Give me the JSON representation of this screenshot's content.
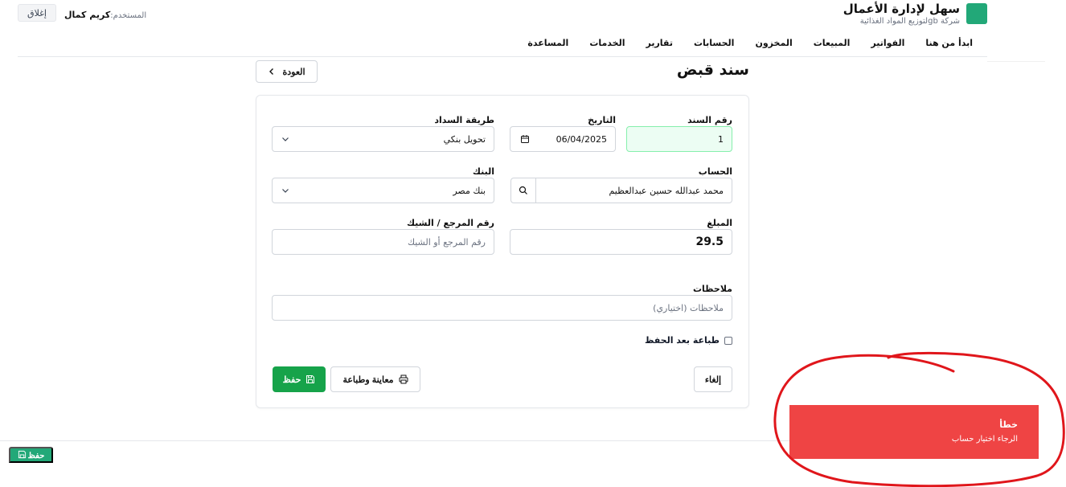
{
  "app": {
    "title": "سهل لإدارة الأعمال",
    "subtitle": "شركة gbلتوزيع المواد الغذائية",
    "brand_color": "#22a878"
  },
  "user": {
    "label": "المستخدم:",
    "name": "كريم كمال",
    "logout_label": "إغلاق"
  },
  "nav": {
    "items": [
      "ابدأ من هنا",
      "الفواتير",
      "المبيعات",
      "المخزون",
      "الحسابات",
      "تقارير",
      "الخدمات",
      "المساعدة"
    ]
  },
  "page": {
    "title": "سند قبض",
    "back_label": "العودة"
  },
  "form": {
    "voucher_number": {
      "label": "رقم السند",
      "value": "1"
    },
    "date": {
      "label": "التاريخ",
      "value": "06/04/2025"
    },
    "payment_method": {
      "label": "طريقة السداد",
      "value": "تحويل بنكي"
    },
    "account": {
      "label": "الحساب",
      "value": "محمد عبدالله حسين عبدالعظيم"
    },
    "bank": {
      "label": "البنك",
      "value": "بنك مصر"
    },
    "amount": {
      "label": "المبلغ",
      "value": "29.5"
    },
    "reference": {
      "label": "رقم المرجع / الشيك",
      "placeholder": "رقم المرجع أو الشيك"
    },
    "notes": {
      "label": "ملاحظات",
      "placeholder": "ملاحظات (اختياري)"
    },
    "print_after_save": {
      "label": "طباعة بعد الحفظ",
      "checked": false
    }
  },
  "buttons": {
    "cancel": "إلغاء",
    "preview_print": "معاينة وطباعة",
    "save": "حفظ",
    "bottom_save": "حفظ"
  },
  "toast": {
    "title": "خطأ",
    "message": "الرجاء اختيار حساب",
    "color": "#ef4444"
  }
}
